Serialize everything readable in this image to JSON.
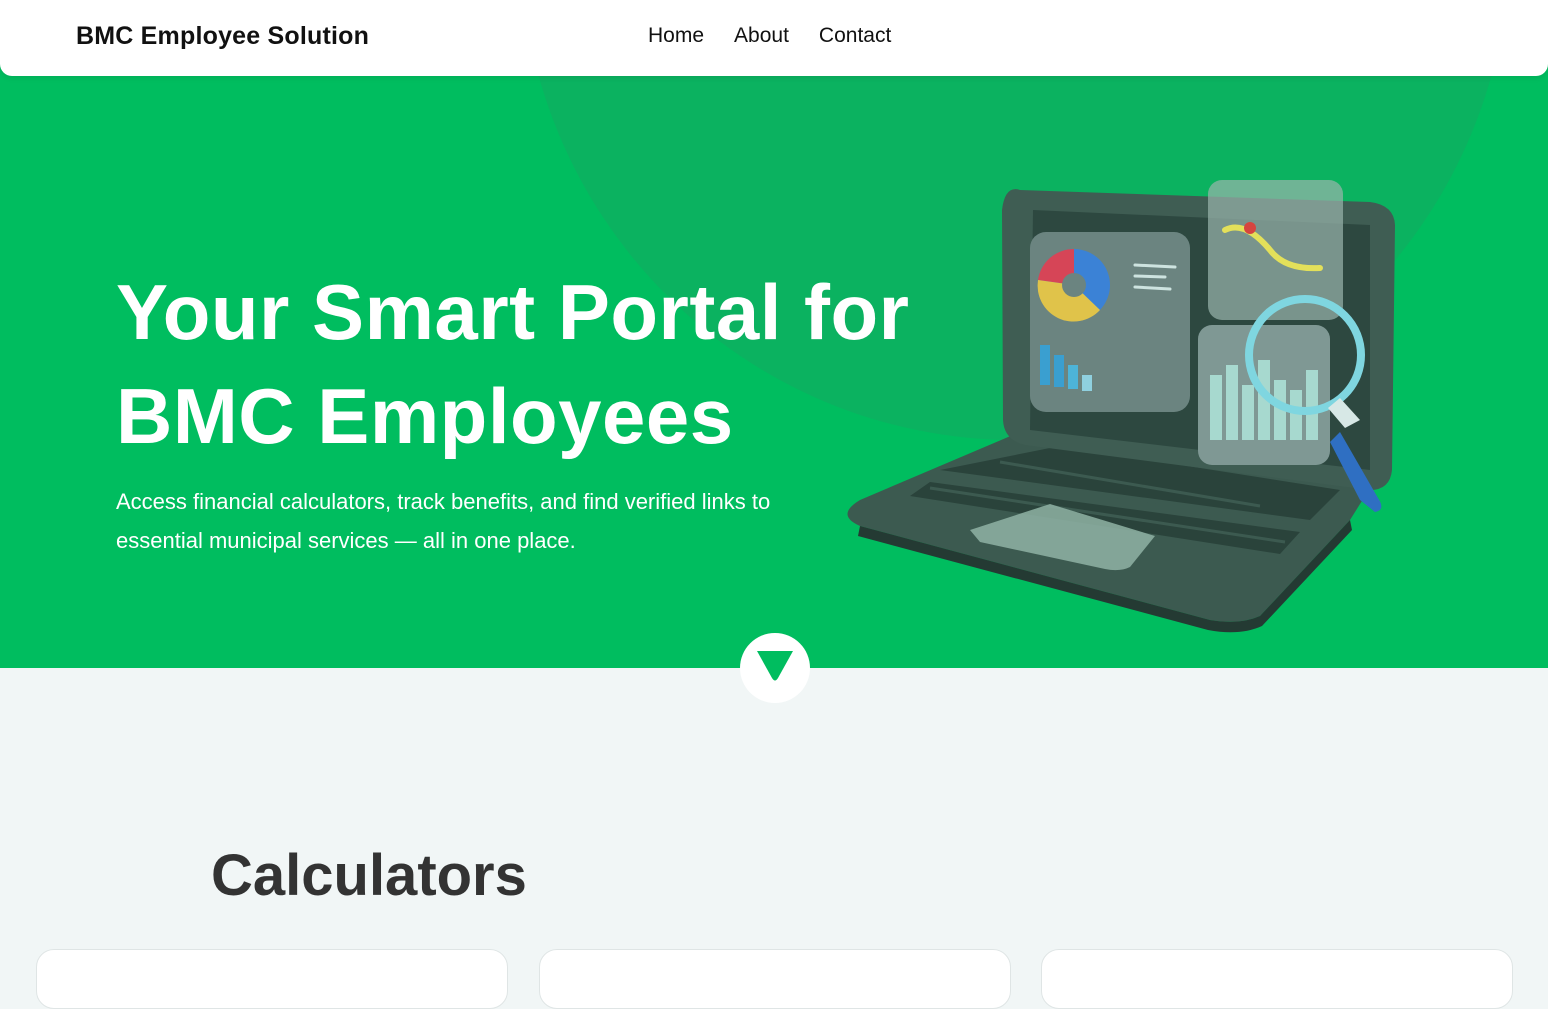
{
  "navbar": {
    "brand": "BMC Employee Solution",
    "links": [
      {
        "label": "Home"
      },
      {
        "label": "About"
      },
      {
        "label": "Contact"
      }
    ]
  },
  "hero": {
    "title_line1": "Your Smart Portal for",
    "title_line2": "BMC Employees",
    "subtitle": "Access financial calculators, track benefits, and find verified links to essential municipal services — all in one place.",
    "background_color": "#00bd5f",
    "illustration_icon": "laptop-analytics-illustration",
    "scroll_icon": "chevron-down-icon"
  },
  "calculators": {
    "heading": "Calculators",
    "cards": [
      {},
      {},
      {}
    ]
  }
}
